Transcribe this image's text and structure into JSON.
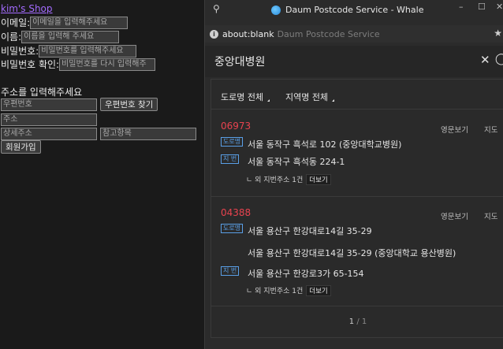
{
  "form": {
    "shop_link": "kim's Shop",
    "email_label": "이메일:",
    "email_placeholder": "이메일을 입력해주세요",
    "name_label": "이름:",
    "name_placeholder": "이름을 입력해 주세요",
    "password_label": "비밀번호:",
    "password_placeholder": "비밀번호를 입력해주세요",
    "password_confirm_label": "비밀번호 확인:",
    "password_confirm_placeholder": "비밀번호를 다시 입력해주",
    "address_title": "주소를 입력해주세요",
    "postcode_placeholder": "우편번호",
    "find_postcode_button": "우편번호 찾기",
    "address_placeholder": "주소",
    "detail_address_placeholder": "상세주소",
    "extra_placeholder": "참고항목",
    "signup_button": "회원가입"
  },
  "popup": {
    "window_title": "Daum Postcode Service - Whale",
    "url": "about:blank",
    "page_title": "Daum Postcode Service",
    "search_query": "중앙대병원",
    "filters": {
      "road": "도로명 전체",
      "region": "지역명 전체"
    },
    "results": [
      {
        "zipcode": "06973",
        "english_label": "영문보기",
        "map_label": "지도",
        "road_tag": "도로명",
        "road_address": "서울 동작구 흑석로 102 (중앙대학교병원)",
        "jibun_tag": "지 번",
        "jibun_address": "서울 동작구 흑석동 224-1",
        "more_text": "ㄴ 외 지번주소 1건",
        "more_button": "더보기"
      },
      {
        "zipcode": "04388",
        "english_label": "영문보기",
        "map_label": "지도",
        "road_tag": "도로명",
        "road_address": "서울 용산구 한강대로14길 35-29",
        "road_address_alt": "서울 용산구 한강대로14길 35-29 (중앙대학교 용산병원)",
        "jibun_tag": "지 번",
        "jibun_address": "서울 용산구 한강로3가 65-154",
        "more_text": "ㄴ 외 지번주소 1건",
        "more_button": "더보기"
      }
    ],
    "pager": {
      "current": "1",
      "total": "/ 1"
    }
  }
}
